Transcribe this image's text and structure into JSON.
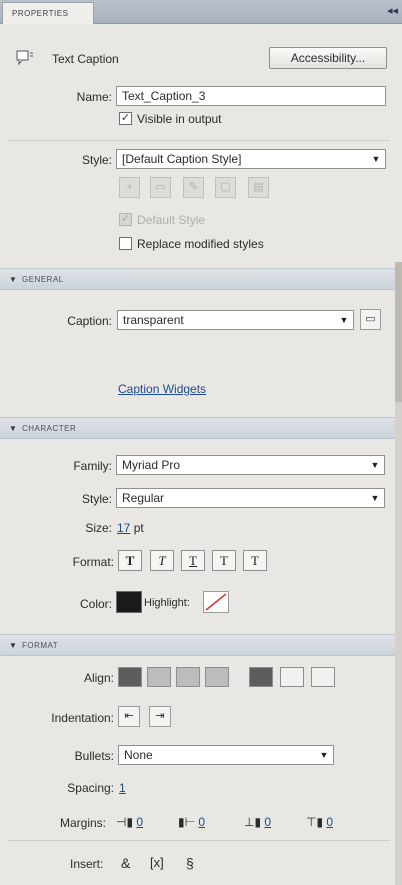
{
  "tab": {
    "label": "PROPERTIES",
    "collapse_icon": "double-chevron-icon"
  },
  "header": {
    "object_type": "Text Caption",
    "accessibility_label": "Accessibility...",
    "name_label": "Name:",
    "name_value": "Text_Caption_3",
    "visible_label": "Visible in output",
    "visible_checked": true
  },
  "style_block": {
    "style_label": "Style:",
    "style_value": "[Default Caption Style]",
    "default_label": "Default Style",
    "replace_label": "Replace modified styles"
  },
  "general": {
    "title": "GENERAL",
    "caption_label": "Caption:",
    "caption_value": "transparent",
    "widgets_link": "Caption Widgets"
  },
  "character": {
    "title": "CHARACTER",
    "family_label": "Family:",
    "family_value": "Myriad Pro",
    "style_label": "Style:",
    "style_value": "Regular",
    "size_label": "Size:",
    "size_value": "17",
    "size_unit": "pt",
    "format_label": "Format:",
    "format_buttons": [
      "T",
      "T",
      "T",
      "T",
      "T"
    ],
    "color_label": "Color:",
    "color_value": "#1a1a1a",
    "highlight_label": "Highlight:"
  },
  "format": {
    "title": "FORMAT",
    "align_label": "Align:",
    "indentation_label": "Indentation:",
    "bullets_label": "Bullets:",
    "bullets_value": "None",
    "spacing_label": "Spacing:",
    "spacing_value": "1",
    "margins_label": "Margins:",
    "margins": [
      "0",
      "0",
      "0",
      "0"
    ],
    "insert_label": "Insert:",
    "insert_symbols": [
      "&",
      "[x]",
      "§"
    ]
  }
}
